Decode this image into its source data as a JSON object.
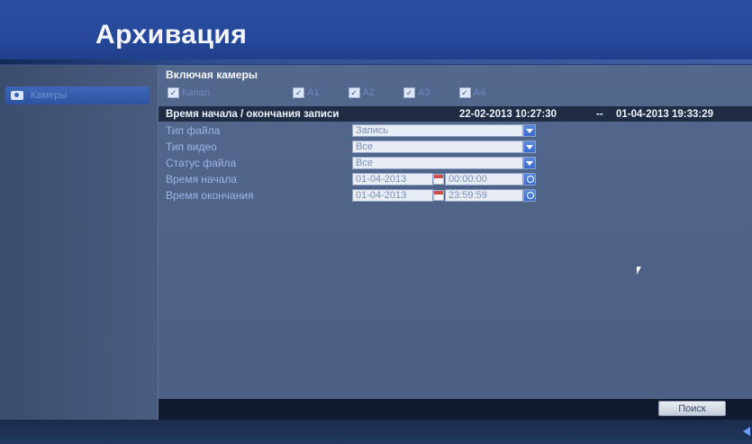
{
  "header": {
    "title": "Архивация"
  },
  "sidebar": {
    "items": [
      {
        "label": "Камеры"
      }
    ]
  },
  "cameras": {
    "heading": "Включая камеры",
    "checkboxes": [
      {
        "label": "Канал",
        "checked": true
      },
      {
        "label": "А1",
        "checked": true
      },
      {
        "label": "А2",
        "checked": true
      },
      {
        "label": "А3",
        "checked": true
      },
      {
        "label": "А4",
        "checked": true
      }
    ]
  },
  "record_time": {
    "label": "Время начала / окончания записи",
    "start": "22-02-2013 10:27:30",
    "separator": "--",
    "end": "01-04-2013 19:33:29"
  },
  "form": {
    "file_type": {
      "label": "Тип файла",
      "value": "Запись"
    },
    "video_type": {
      "label": "Тип видео",
      "value": "Все"
    },
    "file_status": {
      "label": "Статус файла",
      "value": "Все"
    },
    "start_time": {
      "label": "Время начала",
      "date": "01-04-2013",
      "time": "00:00:00"
    },
    "end_time": {
      "label": "Время окончания",
      "date": "01-04-2013",
      "time": "23:59:59"
    }
  },
  "actions": {
    "search": "Поиск"
  },
  "icons": {
    "checkbox": "check-icon",
    "dropdown": "chevron-down-icon",
    "calendar": "calendar-icon",
    "clock": "clock-icon",
    "camera": "camera-icon",
    "back": "back-arrow-icon",
    "cursor": "mouse-cursor-icon"
  }
}
